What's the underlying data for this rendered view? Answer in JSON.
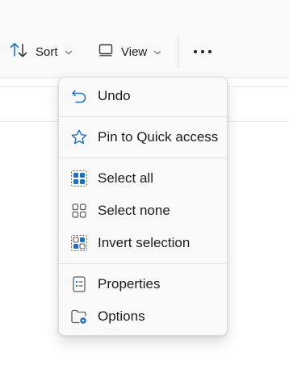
{
  "toolbar": {
    "sort_label": "Sort",
    "view_label": "View"
  },
  "menu": {
    "items": [
      {
        "label": "Undo",
        "icon": "undo-icon"
      },
      {
        "label": "Pin to Quick access",
        "icon": "star-icon"
      },
      {
        "label": "Select all",
        "icon": "select-all-icon"
      },
      {
        "label": "Select none",
        "icon": "select-none-icon"
      },
      {
        "label": "Invert selection",
        "icon": "invert-selection-icon"
      },
      {
        "label": "Properties",
        "icon": "properties-icon"
      },
      {
        "label": "Options",
        "icon": "options-icon"
      }
    ]
  },
  "colors": {
    "accent": "#1f6fc5",
    "icon_gray": "#5f5f5f",
    "menu_bg": "#f9f9f9"
  }
}
